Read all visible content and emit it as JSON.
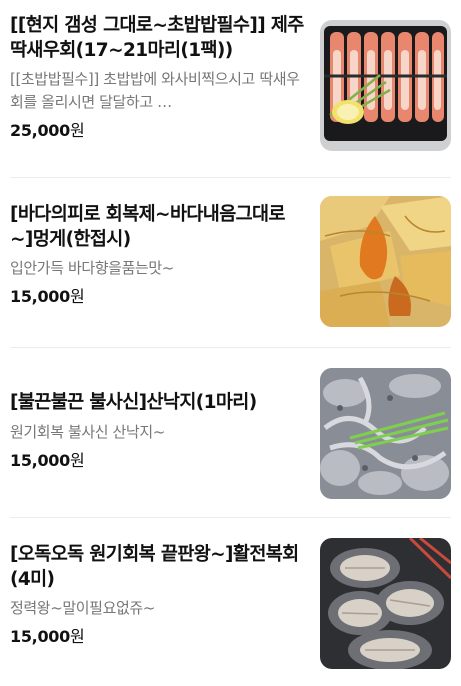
{
  "items": [
    {
      "title": "[[현지 갬성 그대로~초밥밥필수]] 제주 딱새우회(17~21마리(1팩))",
      "description": "[[초밥밥필수]] 초밥밥에 와사비찍으시고 딱새우회를 올리시면 달달하고 …",
      "price": "25,000",
      "currency": "원",
      "image": "sweet-shrimp-sashimi"
    },
    {
      "title": "[바다의피로 회복제~바다내음그대로~]멍게(한접시)",
      "description": "입안가득 바다향을품는맛~",
      "price": "15,000",
      "currency": "원",
      "image": "sea-squirt-plate"
    },
    {
      "title": "[불끈불끈 불사신]산낙지(1마리)",
      "description": "원기회복 불사신 산낙지~",
      "price": "15,000",
      "currency": "원",
      "image": "live-octopus-plate"
    },
    {
      "title": "[오독오독 원기회복 끝판왕~]활전복회(4미)",
      "description": "정력왕~말이필요없쥬~",
      "price": "15,000",
      "currency": "원",
      "image": "abalone-sashimi"
    }
  ]
}
